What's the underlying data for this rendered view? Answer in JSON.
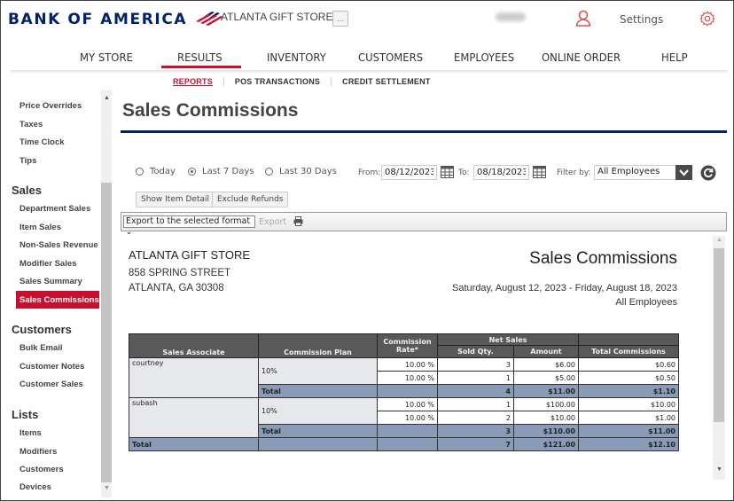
{
  "header": {
    "brand": "BANK OF AMERICA",
    "store_name": "ATLANTA GIFT STORE",
    "more_label": "...",
    "settings_label": "Settings",
    "colors": {
      "brand_navy": "#012169",
      "brand_red": "#c8102e"
    }
  },
  "main_nav": [
    {
      "label": "MY STORE",
      "active": false
    },
    {
      "label": "RESULTS",
      "active": true
    },
    {
      "label": "INVENTORY",
      "active": false
    },
    {
      "label": "CUSTOMERS",
      "active": false
    },
    {
      "label": "EMPLOYEES",
      "active": false
    },
    {
      "label": "ONLINE ORDER",
      "active": false
    },
    {
      "label": "HELP",
      "active": false
    }
  ],
  "sub_nav": [
    {
      "label": "REPORTS",
      "active": true
    },
    {
      "label": "POS TRANSACTIONS",
      "active": false
    },
    {
      "label": "CREDIT SETTLEMENT",
      "active": false
    }
  ],
  "sidebar": {
    "top_items": [
      "Price Overrides",
      "Taxes",
      "Time Clock",
      "Tips"
    ],
    "sections": [
      {
        "heading": "Sales",
        "items": [
          "Department Sales",
          "Item Sales",
          "Non-Sales Revenue",
          "Modifier Sales",
          "Sales Summary",
          "Sales Commissions"
        ],
        "active": "Sales Commissions"
      },
      {
        "heading": "Customers",
        "items": [
          "Bulk Email",
          "Customer Notes",
          "Customer Sales"
        ]
      },
      {
        "heading": "Lists",
        "items": [
          "Items",
          "Modifiers",
          "Customers",
          "Devices"
        ]
      }
    ]
  },
  "page": {
    "title": "Sales Commissions",
    "date_options": [
      {
        "label": "Today",
        "checked": false
      },
      {
        "label": "Last 7 Days",
        "checked": true
      },
      {
        "label": "Last 30 Days",
        "checked": false
      }
    ],
    "from_label": "From:",
    "from_value": "08/12/2023",
    "to_label": "To:",
    "to_value": "08/18/2023",
    "filter_label": "Filter by:",
    "filter_value": "All Employees",
    "buttons": {
      "show_item_detail": "Show Item Detail",
      "exclude_refunds": "Exclude Refunds"
    },
    "export_select": "Export to the selected format",
    "export_label": "Export"
  },
  "report": {
    "store_name": "ATLANTA GIFT STORE",
    "address_line1": "858 SPRING STREET",
    "address_line2": "ATLANTA, GA 30308",
    "title": "Sales Commissions",
    "date_range": "Saturday, August 12, 2023 - Friday, August 18, 2023",
    "filter": "All Employees",
    "columns": {
      "associate": "Sales Associate",
      "plan": "Commission Plan",
      "rate": "Commission Rate*",
      "net_sales": "Net Sales",
      "qty": "Sold Qty.",
      "amount": "Amount",
      "total_commissions": "Total Commissions"
    },
    "total_label": "Total",
    "associates": [
      {
        "name": "courtney",
        "plan": "10%",
        "rows": [
          {
            "rate": "10.00 %",
            "qty": "3",
            "amount": "$6.00",
            "commission": "$0.60"
          },
          {
            "rate": "10.00 %",
            "qty": "1",
            "amount": "$5.00",
            "commission": "$0.50"
          }
        ],
        "total": {
          "qty": "4",
          "amount": "$11.00",
          "commission": "$1.10"
        }
      },
      {
        "name": "subash",
        "plan": "10%",
        "rows": [
          {
            "rate": "10.00 %",
            "qty": "1",
            "amount": "$100.00",
            "commission": "$10.00"
          },
          {
            "rate": "10.00 %",
            "qty": "2",
            "amount": "$10.00",
            "commission": "$1.00"
          }
        ],
        "total": {
          "qty": "3",
          "amount": "$110.00",
          "commission": "$11.00"
        }
      }
    ],
    "grand_total": {
      "qty": "7",
      "amount": "$121.00",
      "commission": "$12.10"
    }
  }
}
